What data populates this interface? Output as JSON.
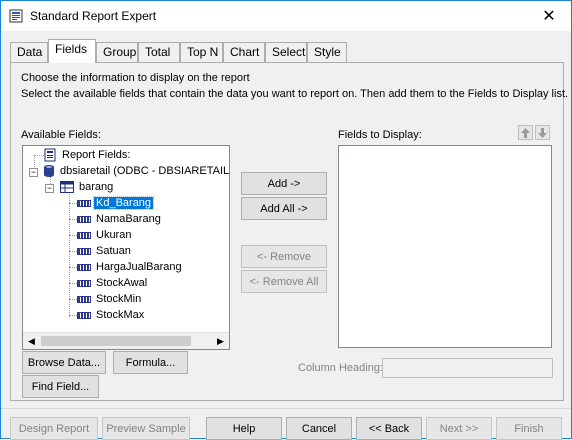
{
  "window": {
    "title": "Standard Report Expert",
    "close_symbol": "✕"
  },
  "tabs": [
    {
      "label": "Data",
      "active": false
    },
    {
      "label": "Fields",
      "active": true
    },
    {
      "label": "Group",
      "active": false
    },
    {
      "label": "Total",
      "active": false
    },
    {
      "label": "Top N",
      "active": false
    },
    {
      "label": "Chart",
      "active": false
    },
    {
      "label": "Select",
      "active": false
    },
    {
      "label": "Style",
      "active": false
    }
  ],
  "instructions": {
    "line1": "Choose the information to display on the report",
    "line2": "Select the available fields that contain the data you want to report on.  Then add them to the Fields to Display list."
  },
  "available_fields": {
    "label": "Available Fields:",
    "root": "Report Fields:",
    "datasource": "dbsiaretail (ODBC - DBSIARETAIL)",
    "table": "barang",
    "fields": [
      "Kd_Barang",
      "NamaBarang",
      "Ukuran",
      "Satuan",
      "HargaJualBarang",
      "StockAwal",
      "StockMin",
      "StockMax"
    ],
    "selected_field": "Kd_Barang"
  },
  "fields_to_display": {
    "label": "Fields to Display:",
    "items": []
  },
  "buttons": {
    "add": "Add ->",
    "add_all": "Add All ->",
    "remove": "<- Remove",
    "remove_all": "<- Remove All",
    "browse_data": "Browse Data...",
    "formula": "Formula...",
    "find_field": "Find Field..."
  },
  "column_heading": {
    "label": "Column Heading:",
    "value": ""
  },
  "footer": {
    "design_report": "Design Report",
    "preview_sample": "Preview Sample",
    "help": "Help",
    "cancel": "Cancel",
    "back": "<< Back",
    "next": "Next >>",
    "finish": "Finish"
  },
  "icons": {
    "app": "report-expert-icon",
    "up_arrow": "move-up-icon",
    "down_arrow": "move-down-icon"
  }
}
